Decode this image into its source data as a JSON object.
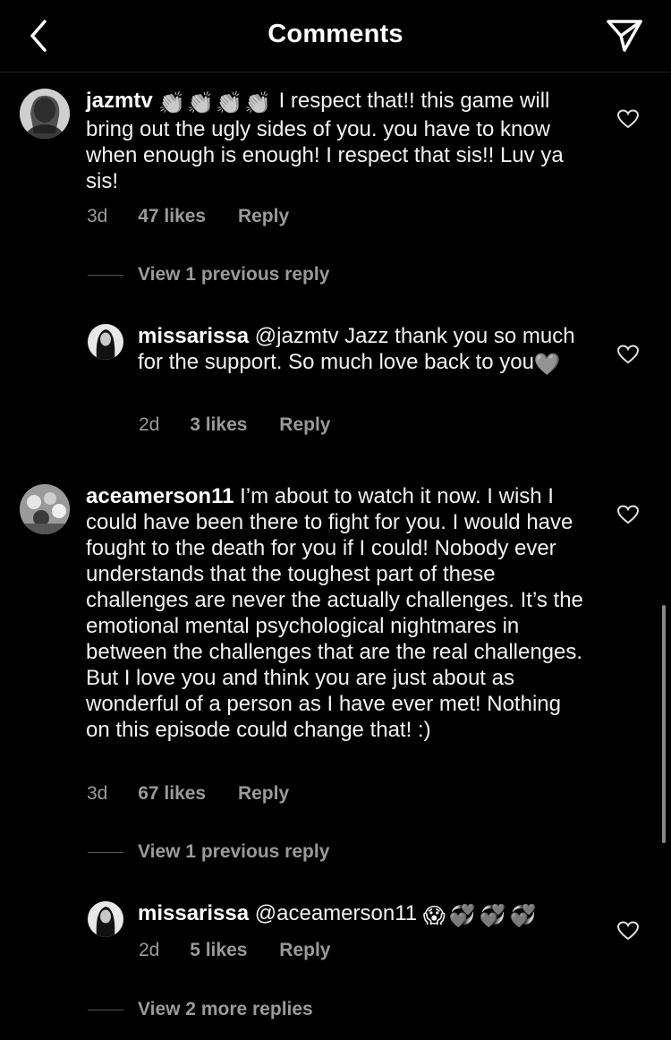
{
  "header": {
    "title": "Comments",
    "back_icon": "chevron-left-icon",
    "send_icon": "paper-plane-icon"
  },
  "comments": [
    {
      "username": "jazmtv",
      "emojis": "👏👏👏👏",
      "body": " I respect that!! this game will bring out the ugly sides of you. you have to know when enough is enough! I respect that sis!! Luv ya sis!",
      "time": "3d",
      "likes": "47 likes",
      "reply": "Reply",
      "view_replies": "View 1 previous reply",
      "replies": [
        {
          "username": "missarissa",
          "body": " @jazmtv Jazz thank you so much for the support. So much love back to you",
          "emoji": "🩶",
          "time": "2d",
          "likes": "3 likes",
          "reply": "Reply"
        }
      ]
    },
    {
      "username": "aceamerson11",
      "body": " I’m about to watch it now. I wish I could have been there to fight for you. I would have fought to the death for you if I could! Nobody ever understands that the toughest part of these challenges are never the actually challenges. It’s the emotional mental psychological nightmares in between the challenges that are the real challenges. But I love you and think you are just about as wonderful of a person as I have ever met! Nothing on this episode could change that! :)",
      "time": "3d",
      "likes": "67 likes",
      "reply": "Reply",
      "view_replies": "View 1 previous reply",
      "replies": [
        {
          "username": "missarissa",
          "body": " @aceamerson11 ",
          "emoji": "😱💞💞💞",
          "time": "2d",
          "likes": "5 likes",
          "reply": "Reply"
        }
      ],
      "more_replies": "View 2 more replies"
    }
  ]
}
